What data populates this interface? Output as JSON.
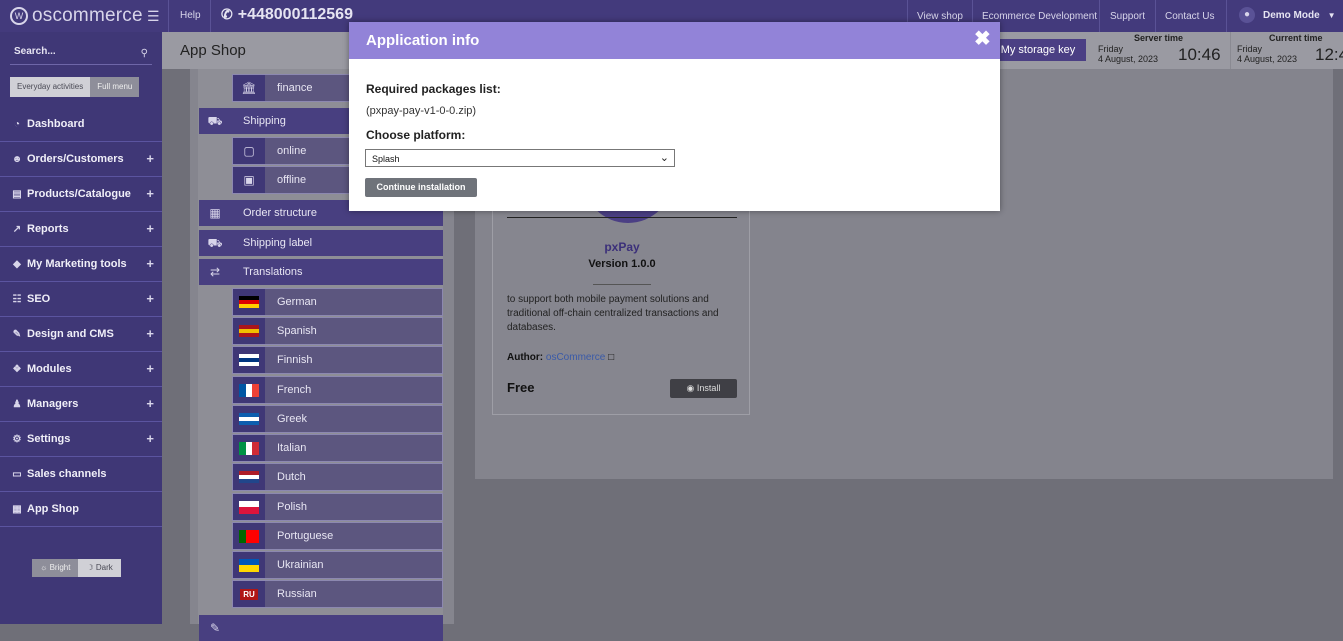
{
  "header": {
    "logo_text": "oscommerce",
    "help": "Help",
    "phone": "+448000112569",
    "links": [
      "View shop",
      "Ecommerce Development",
      "Support",
      "Contact Us"
    ],
    "user": "Demo Mode"
  },
  "sidebar": {
    "search_label": "Search...",
    "mode_everyday": "Everyday activities",
    "mode_full": "Full menu",
    "items": [
      {
        "label": "Dashboard",
        "icon": "dashboard-icon",
        "expandable": false
      },
      {
        "label": "Orders/Customers",
        "icon": "users-icon",
        "expandable": true
      },
      {
        "label": "Products/Catalogue",
        "icon": "folder-icon",
        "expandable": true
      },
      {
        "label": "Reports",
        "icon": "chart-icon",
        "expandable": true
      },
      {
        "label": "My Marketing tools",
        "icon": "tag-icon",
        "expandable": true
      },
      {
        "label": "SEO",
        "icon": "network-icon",
        "expandable": true
      },
      {
        "label": "Design and CMS",
        "icon": "brush-icon",
        "expandable": true
      },
      {
        "label": "Modules",
        "icon": "puzzle-icon",
        "expandable": true
      },
      {
        "label": "Managers",
        "icon": "person-icon",
        "expandable": true
      },
      {
        "label": "Settings",
        "icon": "gears-icon",
        "expandable": true
      },
      {
        "label": "Sales channels",
        "icon": "monitor-icon",
        "expandable": false
      },
      {
        "label": "App Shop",
        "icon": "cart-icon",
        "expandable": false
      }
    ],
    "theme_bright": "Bright",
    "theme_dark": "Dark"
  },
  "main": {
    "page_title": "App Shop",
    "storage_key": "My storage key",
    "server_time": {
      "label": "Server time",
      "day": "Friday",
      "date": "4 August, 2023",
      "time": "10:46"
    },
    "current_time": {
      "label": "Current time",
      "day": "Friday",
      "date": "4 August, 2023",
      "time": "12:4"
    }
  },
  "categories": {
    "finance": "finance",
    "shipping": "Shipping",
    "online": "online",
    "offline": "offline",
    "order_structure": "Order structure",
    "shipping_label": "Shipping label",
    "translations": "Translations",
    "languages": [
      "German",
      "Spanish",
      "Finnish",
      "French",
      "Greek",
      "Italian",
      "Dutch",
      "Polish",
      "Portuguese",
      "Ukrainian",
      "Russian"
    ],
    "russian_badge": "RU"
  },
  "app_card": {
    "name": "pxPay",
    "version": "Version 1.0.0",
    "description": "to support both mobile payment solutions and traditional off-chain centralized transactions and databases.",
    "author_label": "Author:",
    "author": "osCommerce",
    "price": "Free",
    "install": "Install"
  },
  "modal": {
    "title": "Application info",
    "packages_label": "Required packages list:",
    "package": "(pxpay-pay-v1-0-0.zip)",
    "platform_label": "Choose platform:",
    "platform_value": "Splash",
    "continue": "Continue installation"
  },
  "colors": {
    "sidebar": "#3f3776",
    "modal_header": "#9283d8",
    "overlay": "#6f6f78"
  }
}
